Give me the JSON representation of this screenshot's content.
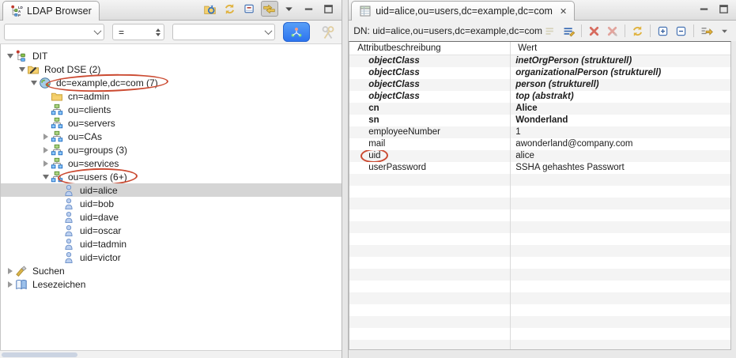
{
  "colors": {
    "annotation_red": "#cb4a31",
    "selection_gray": "#d5d5d5",
    "accent_blue": "#2a72ef"
  },
  "left_panel": {
    "tab": {
      "label": "LDAP Browser",
      "icon": "ldap-browser-icon"
    },
    "toolbar": [
      {
        "name": "open-search-dialog-icon"
      },
      {
        "name": "refresh-icon"
      },
      {
        "name": "collapse-all-icon"
      },
      {
        "name": "link-with-editor-icon",
        "pressed": true
      }
    ],
    "window_controls": [
      {
        "name": "view-menu-icon"
      },
      {
        "name": "minimize-icon"
      },
      {
        "name": "maximize-icon"
      }
    ],
    "search": {
      "attribute_value": "",
      "operator": "=",
      "value_value": "",
      "run_icon": "run-quick-search-icon",
      "disabled_icon": "quick-search-icon"
    },
    "tree": [
      {
        "label": "DIT",
        "icon": "dit-icon",
        "level": 0,
        "expander": "open",
        "selected": false,
        "circled": false
      },
      {
        "label": "Root DSE (2)",
        "icon": "folder-edit-icon",
        "level": 1,
        "expander": "open",
        "selected": false,
        "circled": false
      },
      {
        "label": "dc=example,dc=com (7)",
        "icon": "globe-icon",
        "level": 2,
        "expander": "open",
        "selected": false,
        "circled": true
      },
      {
        "label": "cn=admin",
        "icon": "folder-icon",
        "level": 3,
        "expander": "none",
        "selected": false,
        "circled": false
      },
      {
        "label": "ou=clients",
        "icon": "org-icon",
        "level": 3,
        "expander": "none",
        "selected": false,
        "circled": false
      },
      {
        "label": "ou=servers",
        "icon": "org-icon",
        "level": 3,
        "expander": "none",
        "selected": false,
        "circled": false
      },
      {
        "label": "ou=CAs",
        "icon": "org-icon",
        "level": 3,
        "expander": "closed",
        "selected": false,
        "circled": false
      },
      {
        "label": "ou=groups (3)",
        "icon": "org-icon",
        "level": 3,
        "expander": "closed",
        "selected": false,
        "circled": false
      },
      {
        "label": "ou=services",
        "icon": "org-icon",
        "level": 3,
        "expander": "closed",
        "selected": false,
        "circled": false
      },
      {
        "label": "ou=users (6+)",
        "icon": "org-icon",
        "level": 3,
        "expander": "open",
        "selected": false,
        "circled": true
      },
      {
        "label": "uid=alice",
        "icon": "person-icon",
        "level": 4,
        "expander": "none",
        "selected": true,
        "circled": false
      },
      {
        "label": "uid=bob",
        "icon": "person-icon",
        "level": 4,
        "expander": "none",
        "selected": false,
        "circled": false
      },
      {
        "label": "uid=dave",
        "icon": "person-icon",
        "level": 4,
        "expander": "none",
        "selected": false,
        "circled": false
      },
      {
        "label": "uid=oscar",
        "icon": "person-icon",
        "level": 4,
        "expander": "none",
        "selected": false,
        "circled": false
      },
      {
        "label": "uid=tadmin",
        "icon": "person-icon",
        "level": 4,
        "expander": "none",
        "selected": false,
        "circled": false
      },
      {
        "label": "uid=victor",
        "icon": "person-icon",
        "level": 4,
        "expander": "none",
        "selected": false,
        "circled": false
      },
      {
        "label": "Suchen",
        "icon": "search-icon",
        "level": 0,
        "expander": "closed",
        "selected": false,
        "circled": false
      },
      {
        "label": "Lesezeichen",
        "icon": "bookmark-icon",
        "level": 0,
        "expander": "closed",
        "selected": false,
        "circled": false
      }
    ]
  },
  "right_panel": {
    "tab": {
      "label": "uid=alice,ou=users,dc=example,dc=com",
      "icon": "entry-editor-icon",
      "close_icon": "close-icon"
    },
    "window_controls": [
      {
        "name": "minimize-icon"
      },
      {
        "name": "maximize-icon"
      }
    ],
    "dn_label": "DN: uid=alice,ou=users,dc=example,dc=com",
    "toolbar": [
      {
        "name": "new-value-icon",
        "disabled": true
      },
      {
        "name": "edit-value-icon"
      },
      {
        "sep": true
      },
      {
        "name": "delete-value-icon"
      },
      {
        "name": "delete-attribute-icon",
        "disabled": true
      },
      {
        "sep": true
      },
      {
        "name": "refresh-icon"
      },
      {
        "sep": true
      },
      {
        "name": "expand-values-icon"
      },
      {
        "name": "collapse-values-icon"
      },
      {
        "sep": true
      },
      {
        "name": "fetch-operational-attributes-icon"
      },
      {
        "name": "menu-chevron-icon",
        "small": true
      }
    ],
    "table": {
      "headers": [
        "Attributbeschreibung",
        "Wert"
      ],
      "rows": [
        {
          "attribute": "objectClass",
          "value": "inetOrgPerson (strukturell)",
          "style": "objectclass",
          "attr_circled": false
        },
        {
          "attribute": "objectClass",
          "value": "organizationalPerson (strukturell)",
          "style": "objectclass",
          "attr_circled": false
        },
        {
          "attribute": "objectClass",
          "value": "person (strukturell)",
          "style": "objectclass",
          "attr_circled": false
        },
        {
          "attribute": "objectClass",
          "value": "top (abstrakt)",
          "style": "objectclass",
          "attr_circled": false
        },
        {
          "attribute": "cn",
          "value": "Alice",
          "style": "must",
          "attr_circled": false
        },
        {
          "attribute": "sn",
          "value": "Wonderland",
          "style": "must",
          "attr_circled": false
        },
        {
          "attribute": "employeeNumber",
          "value": "1",
          "style": "normal",
          "attr_circled": false
        },
        {
          "attribute": "mail",
          "value": "awonderland@company.com",
          "style": "normal",
          "attr_circled": false
        },
        {
          "attribute": "uid",
          "value": "alice",
          "style": "normal",
          "attr_circled": true
        },
        {
          "attribute": "userPassword",
          "value": "SSHA gehashtes Passwort",
          "style": "normal",
          "attr_circled": false
        }
      ]
    }
  }
}
